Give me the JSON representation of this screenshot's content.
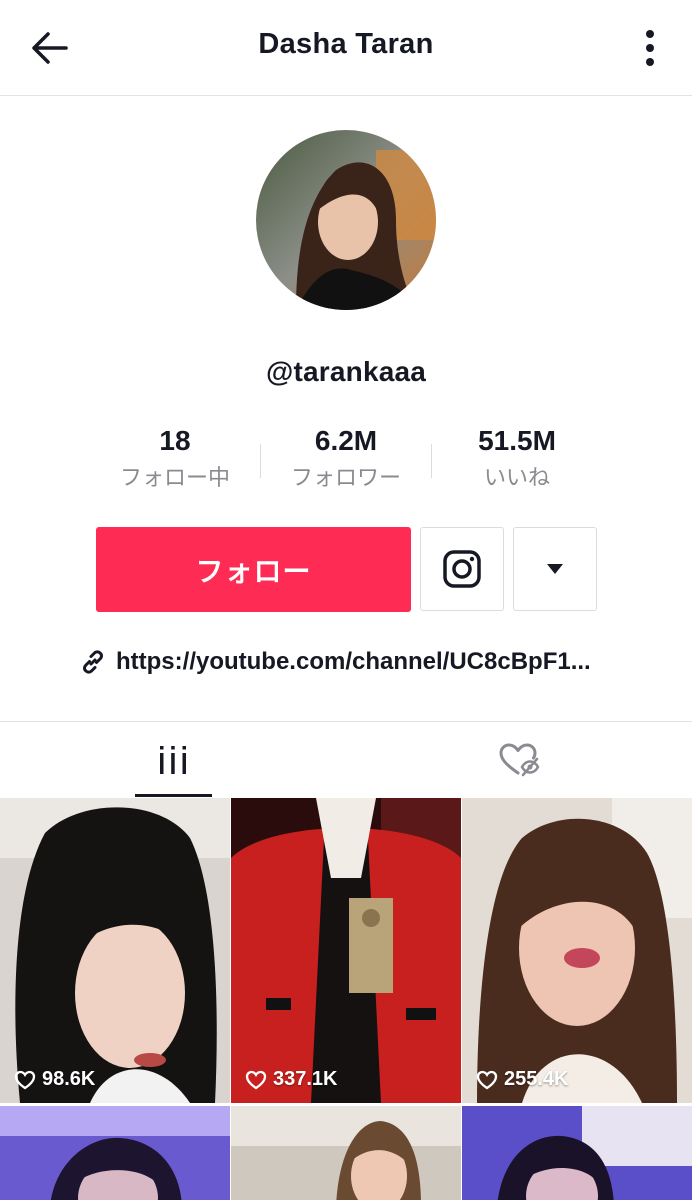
{
  "header": {
    "title": "Dasha Taran",
    "back_icon": "arrow-left-icon",
    "more_icon": "vertical-dots-icon"
  },
  "profile": {
    "username": "@tarankaaa",
    "stats": [
      {
        "value": "18",
        "label": "フォロー中"
      },
      {
        "value": "6.2M",
        "label": "フォロワー"
      },
      {
        "value": "51.5M",
        "label": "いいね"
      }
    ],
    "follow_label": "フォロー",
    "instagram_icon": "instagram-icon",
    "dropdown_icon": "caret-down-icon",
    "link_icon": "link-icon",
    "bio_link": "https://youtube.com/channel/UC8cBpF1..."
  },
  "tabs": [
    {
      "icon": "videos-grid-icon",
      "active": true
    },
    {
      "icon": "liked-hidden-icon",
      "active": false
    }
  ],
  "videos": [
    {
      "likes": "98.6K"
    },
    {
      "likes": "337.1K"
    },
    {
      "likes": "255.4K"
    },
    {
      "likes": ""
    },
    {
      "likes": ""
    },
    {
      "likes": ""
    }
  ],
  "colors": {
    "accent": "#fe2c55",
    "text": "#161823",
    "muted": "#8a8b91",
    "border": "#e3e3e4"
  }
}
